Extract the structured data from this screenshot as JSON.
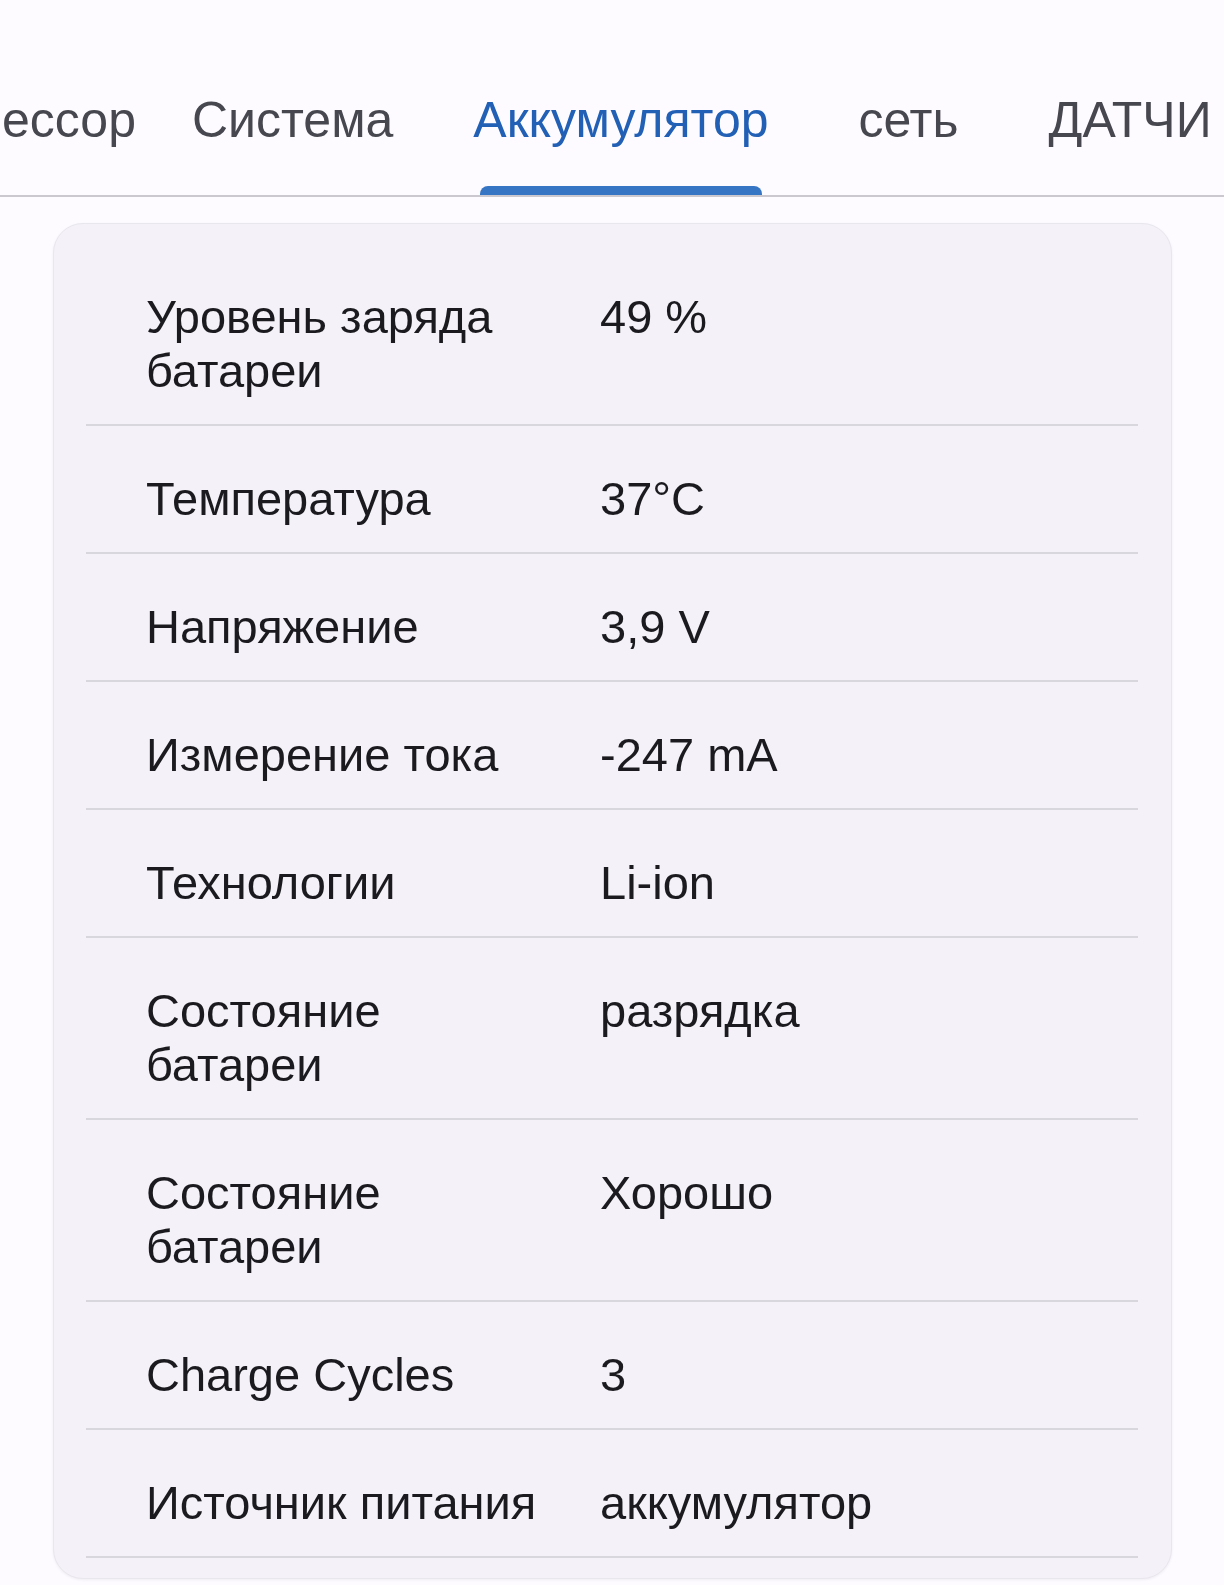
{
  "tabs": [
    {
      "label": "ессор",
      "selected": false
    },
    {
      "label": "Система",
      "selected": false
    },
    {
      "label": "Аккумулятор",
      "selected": true
    },
    {
      "label": "сеть",
      "selected": false
    },
    {
      "label": "ДАТЧИ",
      "selected": false
    }
  ],
  "battery_info": {
    "rows": [
      {
        "label": "Уровень заряда батареи",
        "value": "49 %"
      },
      {
        "label": "Температура",
        "value": "37°C"
      },
      {
        "label": "Напряжение",
        "value": "3,9 V"
      },
      {
        "label": "Измерение тока",
        "value": "-247 mA"
      },
      {
        "label": "Технологии",
        "value": "Li-ion"
      },
      {
        "label": "Состояние батареи",
        "value": "разрядка"
      },
      {
        "label": "Состояние батареи",
        "value": "Хорошо"
      },
      {
        "label": "Charge Cycles",
        "value": "3"
      },
      {
        "label": "Источник питания",
        "value": "аккумулятор"
      }
    ]
  }
}
